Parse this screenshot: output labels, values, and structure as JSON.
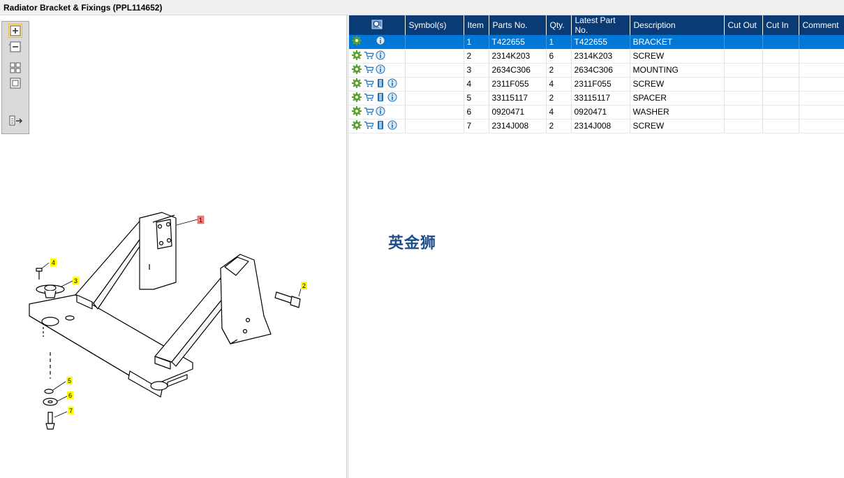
{
  "window": {
    "title": "Radiator Bracket & Fixings (PPL114652)"
  },
  "toolbar": {
    "tools": [
      {
        "name": "zoom-in-icon"
      },
      {
        "name": "zoom-out-icon"
      },
      {
        "name": "fit-all-icon"
      },
      {
        "name": "fit-window-icon"
      },
      {
        "name": "export-icon"
      }
    ]
  },
  "callouts": [
    "1",
    "2",
    "3",
    "4",
    "5",
    "6",
    "7"
  ],
  "table": {
    "columns": [
      "",
      "Symbol(s)",
      "Item",
      "Parts No.",
      "Qty.",
      "Latest Part No.",
      "Description",
      "Cut Out",
      "Cut In",
      "Comment"
    ],
    "rows": [
      {
        "icons": [
          "gear-icon",
          "cart-icon",
          "info-icon"
        ],
        "symbol": "",
        "item": "1",
        "part": "T422655",
        "qty": "1",
        "latest": "T422655",
        "desc": "BRACKET",
        "cut_out": "",
        "cut_in": "",
        "comment": "",
        "selected": true
      },
      {
        "icons": [
          "gear-icon",
          "cart-icon",
          "info-icon"
        ],
        "symbol": "",
        "item": "2",
        "part": "2314K203",
        "qty": "6",
        "latest": "2314K203",
        "desc": "SCREW",
        "cut_out": "",
        "cut_in": "",
        "comment": ""
      },
      {
        "icons": [
          "gear-icon",
          "cart-icon",
          "info-icon"
        ],
        "symbol": "",
        "item": "3",
        "part": "2634C306",
        "qty": "2",
        "latest": "2634C306",
        "desc": "MOUNTING",
        "cut_out": "",
        "cut_in": "",
        "comment": ""
      },
      {
        "icons": [
          "gear-icon",
          "cart-icon",
          "book-icon",
          "info-icon"
        ],
        "symbol": "",
        "item": "4",
        "part": "2311F055",
        "qty": "4",
        "latest": "2311F055",
        "desc": "SCREW",
        "cut_out": "",
        "cut_in": "",
        "comment": ""
      },
      {
        "icons": [
          "gear-icon",
          "cart-icon",
          "book-icon",
          "info-icon"
        ],
        "symbol": "",
        "item": "5",
        "part": "33115117",
        "qty": "2",
        "latest": "33115117",
        "desc": "SPACER",
        "cut_out": "",
        "cut_in": "",
        "comment": ""
      },
      {
        "icons": [
          "gear-icon",
          "cart-icon",
          "info-icon"
        ],
        "symbol": "",
        "item": "6",
        "part": "0920471",
        "qty": "4",
        "latest": "0920471",
        "desc": "WASHER",
        "cut_out": "",
        "cut_in": "",
        "comment": ""
      },
      {
        "icons": [
          "gear-icon",
          "cart-icon",
          "book-icon",
          "info-icon"
        ],
        "symbol": "",
        "item": "7",
        "part": "2314J008",
        "qty": "2",
        "latest": "2314J008",
        "desc": "SCREW",
        "cut_out": "",
        "cut_in": "",
        "comment": ""
      }
    ]
  },
  "watermark": "英金狮",
  "colors": {
    "header": "#0a3b75",
    "selected_row": "#0078d7",
    "callout_yellow": "#ffff00",
    "callout_red": "#ff6b6b"
  }
}
